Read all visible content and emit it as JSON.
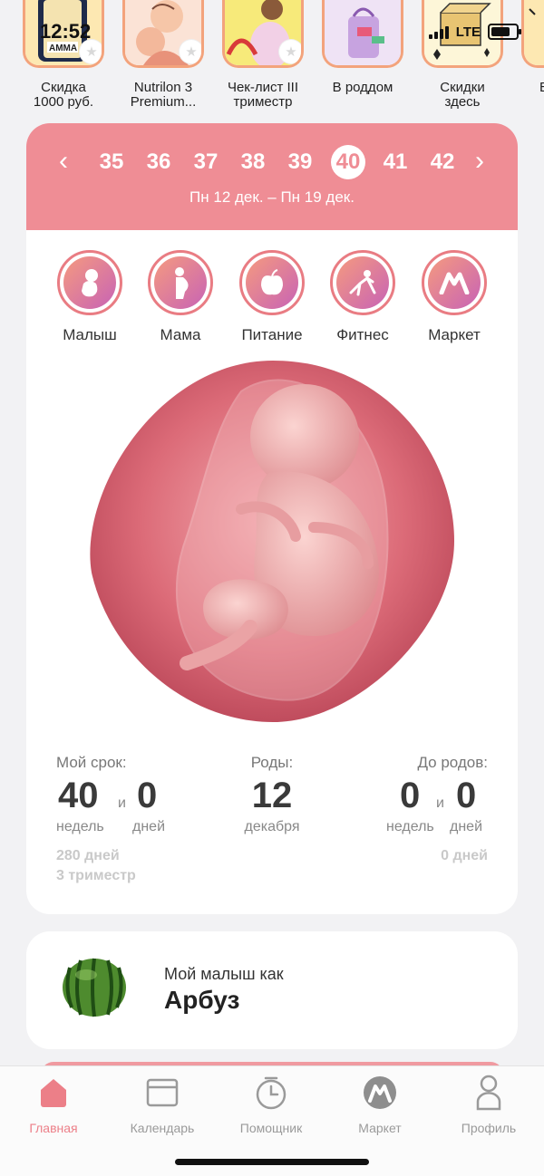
{
  "status_bar": {
    "time": "12:52",
    "network": "LTE"
  },
  "stories": [
    {
      "label": "Скидка\n1000 руб.",
      "badge": "АММА"
    },
    {
      "label": "Nutrilon 3\nPremium..."
    },
    {
      "label": "Чек-лист III\nтриместр"
    },
    {
      "label": "В роддом"
    },
    {
      "label": "Скидки\nздесь"
    },
    {
      "label": "Выб"
    }
  ],
  "week_nav": {
    "weeks": [
      "35",
      "36",
      "37",
      "38",
      "39",
      "40",
      "41",
      "42"
    ],
    "active_week": "40",
    "prev_icon": "chevron-left-icon",
    "next_icon": "chevron-right-icon",
    "date_range": "Пн 12 дек. – Пн 19 дек."
  },
  "categories": [
    {
      "label": "Малыш",
      "icon": "baby-icon"
    },
    {
      "label": "Мама",
      "icon": "pregnant-woman-icon"
    },
    {
      "label": "Питание",
      "icon": "apple-icon"
    },
    {
      "label": "Фитнес",
      "icon": "fitness-icon"
    },
    {
      "label": "Маркет",
      "icon": "market-logo-icon"
    }
  ],
  "stats": {
    "my_term": {
      "title": "Мой срок:",
      "weeks": "40",
      "and": "и",
      "days": "0",
      "weeks_unit": "недель",
      "days_unit": "дней",
      "total_days": "280 дней",
      "trimester": "3 триместр"
    },
    "birth": {
      "title": "Роды:",
      "day": "12",
      "month": "декабря"
    },
    "until_birth": {
      "title": "До родов:",
      "weeks": "0",
      "and": "и",
      "days": "0",
      "weeks_unit": "недель",
      "days_unit": "дней",
      "total_days": "0 дней"
    }
  },
  "baby_size": {
    "title": "Мой малыш как",
    "fruit": "Арбуз"
  },
  "tabbar": [
    {
      "label": "Главная",
      "icon": "home-icon",
      "active": true
    },
    {
      "label": "Календарь",
      "icon": "calendar-icon",
      "active": false
    },
    {
      "label": "Помощник",
      "icon": "timer-icon",
      "active": false
    },
    {
      "label": "Маркет",
      "icon": "market-logo-icon",
      "active": false
    },
    {
      "label": "Профиль",
      "icon": "profile-icon",
      "active": false
    }
  ],
  "colors": {
    "accent": "#ef8d95",
    "tab_active": "#ec7f88",
    "gradient_start": "#f59a7f",
    "gradient_end": "#c863b5"
  }
}
